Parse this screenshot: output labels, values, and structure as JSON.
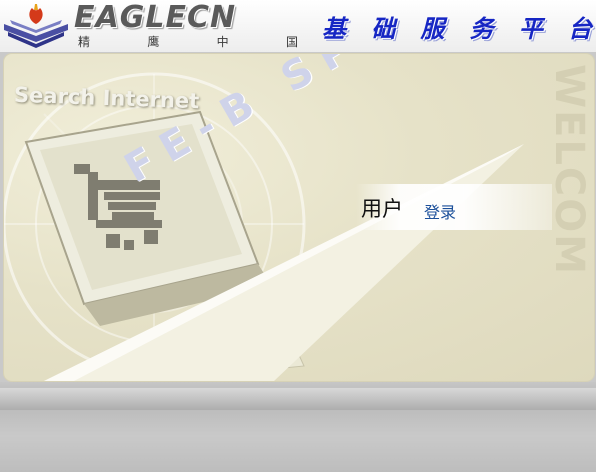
{
  "header": {
    "brand": "EAGLECN",
    "brand_sub": [
      "精",
      "鹰",
      "中",
      "国"
    ],
    "platform_title": [
      "基",
      "础",
      "服",
      "务",
      "平",
      "台"
    ]
  },
  "banner": {
    "search_text": "Search Internet",
    "side_text": "WELCOM",
    "sweep_text": "FE-B SP"
  },
  "login": {
    "user_label": "用户",
    "login_link": "登录"
  },
  "colors": {
    "title_blue": "#1626c4",
    "link_blue": "#1b4f9a",
    "panel_bg": "#e6e2c8"
  }
}
